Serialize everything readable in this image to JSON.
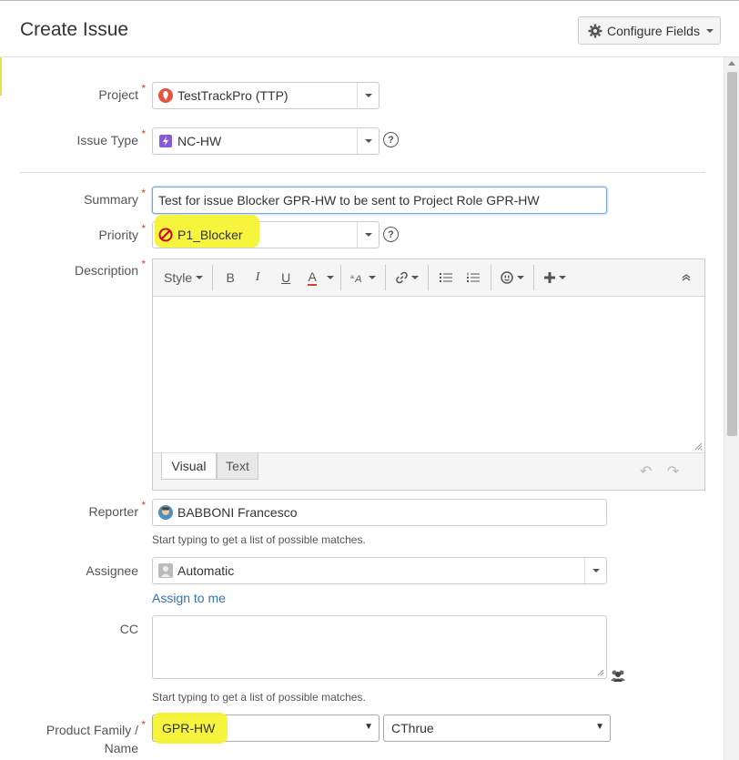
{
  "dialog": {
    "title": "Create Issue",
    "configure_fields": "Configure Fields"
  },
  "fields": {
    "project": {
      "label": "Project",
      "value": "TestTrackPro (TTP)"
    },
    "issue_type": {
      "label": "Issue Type",
      "value": "NC-HW"
    },
    "summary": {
      "label": "Summary",
      "value": "Test for issue Blocker GPR-HW to be sent to Project Role GPR-HW"
    },
    "priority": {
      "label": "Priority",
      "value": "P1_Blocker"
    },
    "description": {
      "label": "Description",
      "toolbar": {
        "style": "Style",
        "bold": "B",
        "italic": "I",
        "underline": "U",
        "color": "A"
      },
      "tabs": {
        "visual": "Visual",
        "text": "Text"
      }
    },
    "reporter": {
      "label": "Reporter",
      "value": "BABBONI Francesco",
      "hint": "Start typing to get a list of possible matches."
    },
    "assignee": {
      "label": "Assignee",
      "value": "Automatic",
      "assign_to_me": "Assign to me"
    },
    "cc": {
      "label": "CC",
      "hint": "Start typing to get a list of possible matches."
    },
    "product_family": {
      "label_line1": "Product Family /",
      "label_line2": "Name",
      "family_value": "GPR-HW",
      "name_value": "CThrue"
    }
  },
  "colors": {
    "required": "#d04437",
    "link": "#3572b0",
    "highlight": "#f5f332",
    "issue_type_icon": "#8b5bd6",
    "priority_icon": "#d0021b"
  }
}
